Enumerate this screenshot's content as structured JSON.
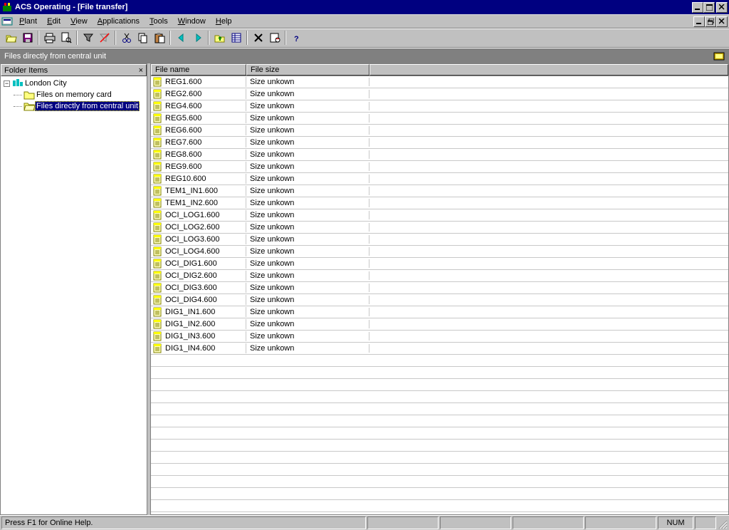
{
  "window": {
    "title": "ACS Operating - [File transfer]"
  },
  "menu": {
    "plant": "Plant",
    "edit": "Edit",
    "view": "View",
    "applications": "Applications",
    "tools": "Tools",
    "window": "Window",
    "help": "Help"
  },
  "section": {
    "title": "Files directly from central unit"
  },
  "tree": {
    "header": "Folder Items",
    "root": "London City",
    "node1": "Files on memory card",
    "node2": "Files directly from central unit"
  },
  "list": {
    "col_name": "File name",
    "col_size": "File size",
    "rows": [
      {
        "name": "REG1.600",
        "size": "Size unkown"
      },
      {
        "name": "REG2.600",
        "size": "Size unkown"
      },
      {
        "name": "REG4.600",
        "size": "Size unkown"
      },
      {
        "name": "REG5.600",
        "size": "Size unkown"
      },
      {
        "name": "REG6.600",
        "size": "Size unkown"
      },
      {
        "name": "REG7.600",
        "size": "Size unkown"
      },
      {
        "name": "REG8.600",
        "size": "Size unkown"
      },
      {
        "name": "REG9.600",
        "size": "Size unkown"
      },
      {
        "name": "REG10.600",
        "size": "Size unkown"
      },
      {
        "name": "TEM1_IN1.600",
        "size": "Size unkown"
      },
      {
        "name": "TEM1_IN2.600",
        "size": "Size unkown"
      },
      {
        "name": "OCI_LOG1.600",
        "size": "Size unkown"
      },
      {
        "name": "OCI_LOG2.600",
        "size": "Size unkown"
      },
      {
        "name": "OCI_LOG3.600",
        "size": "Size unkown"
      },
      {
        "name": "OCI_LOG4.600",
        "size": "Size unkown"
      },
      {
        "name": "OCI_DIG1.600",
        "size": "Size unkown"
      },
      {
        "name": "OCI_DIG2.600",
        "size": "Size unkown"
      },
      {
        "name": "OCI_DIG3.600",
        "size": "Size unkown"
      },
      {
        "name": "OCI_DIG4.600",
        "size": "Size unkown"
      },
      {
        "name": "DIG1_IN1.600",
        "size": "Size unkown"
      },
      {
        "name": "DIG1_IN2.600",
        "size": "Size unkown"
      },
      {
        "name": "DIG1_IN3.600",
        "size": "Size unkown"
      },
      {
        "name": "DIG1_IN4.600",
        "size": "Size unkown"
      }
    ],
    "empty_rows": 13
  },
  "status": {
    "text": "Press F1 for Online Help.",
    "num": "NUM"
  }
}
